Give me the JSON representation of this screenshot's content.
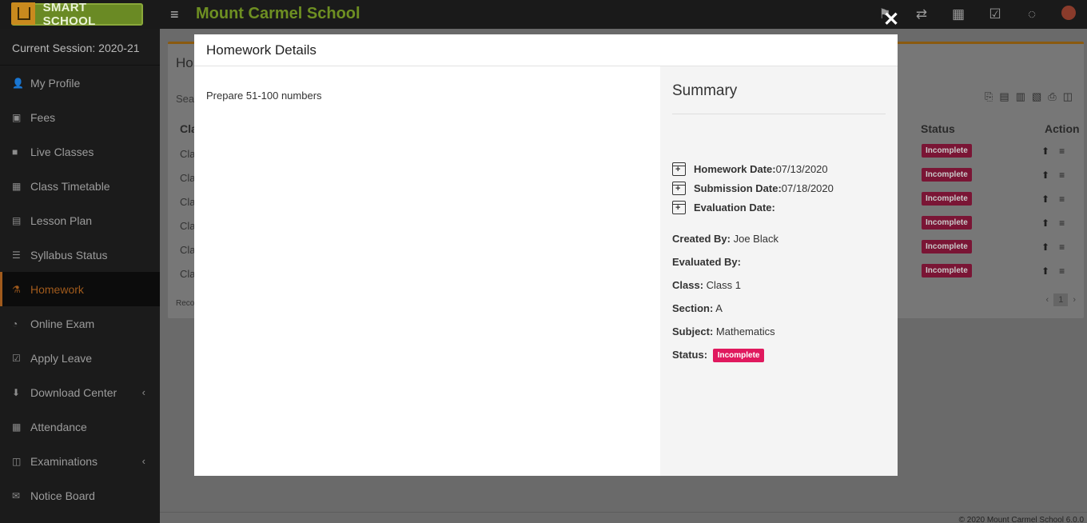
{
  "app": {
    "logo_text": "SMART SCHOOL",
    "school_name": "Mount Carmel School",
    "footer": "© 2020 Mount Carmel School 6.0.0"
  },
  "top_icons": [
    "flag-icon",
    "swap-icon",
    "calendar-icon",
    "check-square-icon",
    "whatsapp-icon",
    "avatar"
  ],
  "sidebar": {
    "session": "Current Session: 2020-21",
    "items": [
      {
        "label": "My Profile",
        "icon": "user-plus-icon",
        "glyph": "👤"
      },
      {
        "label": "Fees",
        "icon": "money-icon",
        "glyph": "▣"
      },
      {
        "label": "Live Classes",
        "icon": "video-icon",
        "glyph": "■"
      },
      {
        "label": "Class Timetable",
        "icon": "calendar-icon",
        "glyph": "▦"
      },
      {
        "label": "Lesson Plan",
        "icon": "list-alt-icon",
        "glyph": "▤"
      },
      {
        "label": "Syllabus Status",
        "icon": "list-ol-icon",
        "glyph": "☰"
      },
      {
        "label": "Homework",
        "icon": "flask-icon",
        "glyph": "⚗",
        "active": true
      },
      {
        "label": "Online Exam",
        "icon": "rss-icon",
        "glyph": "◔"
      },
      {
        "label": "Apply Leave",
        "icon": "check-square-icon",
        "glyph": "☑"
      },
      {
        "label": "Download Center",
        "icon": "download-icon",
        "glyph": "⬇",
        "caret": true
      },
      {
        "label": "Attendance",
        "icon": "calendar-check-icon",
        "glyph": "▦"
      },
      {
        "label": "Examinations",
        "icon": "map-icon",
        "glyph": "◫",
        "caret": true
      },
      {
        "label": "Notice Board",
        "icon": "envelope-icon",
        "glyph": "✉"
      }
    ]
  },
  "background_panel": {
    "title": "Ho",
    "search": "Sea",
    "columns": {
      "class": "Cla",
      "status": "Status",
      "action": "Action"
    },
    "rows": [
      {
        "class": "Cla",
        "status": "Incomplete"
      },
      {
        "class": "Cla",
        "status": "Incomplete"
      },
      {
        "class": "Cla",
        "status": "Incomplete"
      },
      {
        "class": "Cla",
        "status": "Incomplete"
      },
      {
        "class": "Cla",
        "status": "Incomplete"
      },
      {
        "class": "Cla",
        "status": "Incomplete"
      }
    ],
    "records": "Reco",
    "page": "1"
  },
  "modal": {
    "title": "Homework Details",
    "description": "Prepare 51-100 numbers",
    "summary": {
      "title": "Summary",
      "homework_date_label": "Homework Date:",
      "homework_date": "07/13/2020",
      "submission_date_label": "Submission Date:",
      "submission_date": "07/18/2020",
      "evaluation_date_label": "Evaluation Date:",
      "evaluation_date": "",
      "created_by_label": "Created By:",
      "created_by": "Joe Black",
      "evaluated_by_label": "Evaluated By:",
      "evaluated_by": "",
      "class_label": "Class:",
      "class": "Class 1",
      "section_label": "Section:",
      "section": "A",
      "subject_label": "Subject:",
      "subject": "Mathematics",
      "status_label": "Status:",
      "status": "Incomplete",
      "status_color": "#e0195e"
    }
  }
}
